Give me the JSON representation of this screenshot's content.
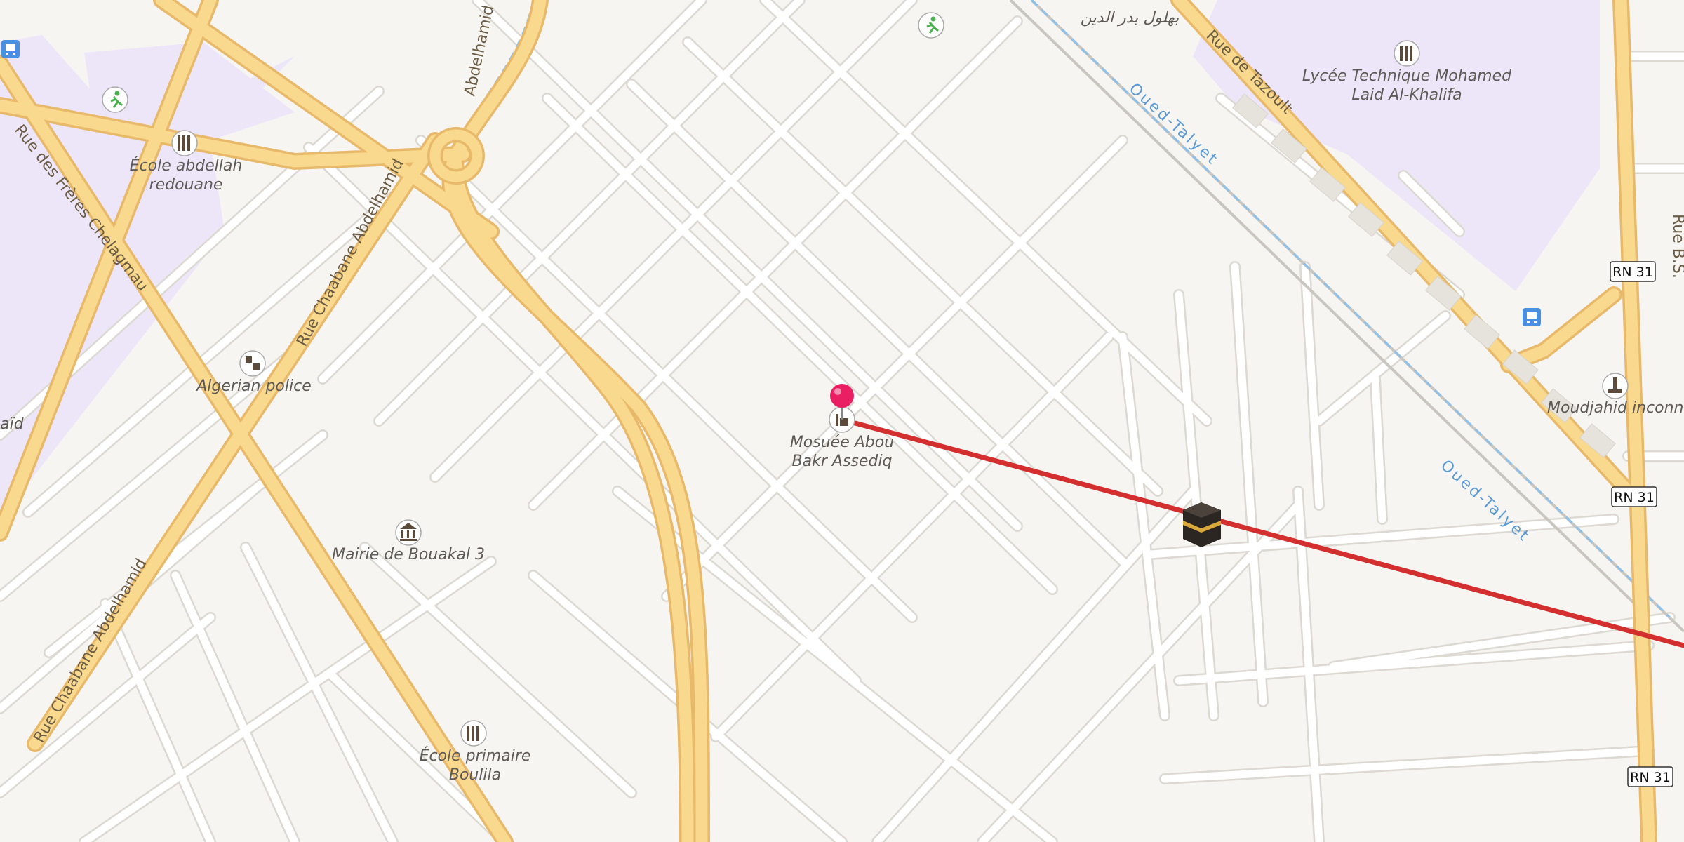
{
  "map": {
    "colors": {
      "land": "#f7f5f2",
      "minor_road": "#ffffff",
      "major_road": "#f8d98d",
      "major_road_casing": "#e8b96a",
      "school_area": "#ede6f8",
      "route_line": "#d32f2f",
      "pin": "#e91e63",
      "water": "#8ec1ea"
    },
    "pois": [
      {
        "name": "École abdellah redouane",
        "line1": "École abdellah",
        "line2": "redouane",
        "icon": "school-icon"
      },
      {
        "name": "Algerian police",
        "line1": "Algerian police",
        "icon": "police-icon"
      },
      {
        "name": "Mairie de Bouakal 3",
        "line1": "Mairie de Bouakal 3",
        "icon": "town-hall-icon"
      },
      {
        "name": "École primaire Boulila",
        "line1": "École primaire",
        "line2": "Boulila",
        "icon": "school-icon"
      },
      {
        "name": "Mosuée Abou Bakr Assediq",
        "line1": "Mosuée Abou",
        "line2": "Bakr Assediq",
        "icon": "mosque-icon"
      },
      {
        "name": "Lycée Technique Mohamed Laid Al-Khalifa",
        "line1": "Lycée Technique Mohamed",
        "line2": "Laid Al-Khalifa",
        "icon": "school-icon"
      },
      {
        "name": "Moudjahid inconnu",
        "line1": "Moudjahid inconnu",
        "icon": "monument-icon"
      },
      {
        "name": "بهلول بدر الدين",
        "line1": "بهلول بدر الدين",
        "icon": ""
      }
    ],
    "streets": [
      {
        "name": "Rue des Frères Chelagmau"
      },
      {
        "name": "Rue Chaabane Abdelhamid"
      },
      {
        "name": "Rue Chaabane Abdelhamid"
      },
      {
        "name": "Abdelhamid"
      },
      {
        "name": "Rue de Tazoult"
      },
      {
        "name": "Rue B.S."
      }
    ],
    "waterways": [
      {
        "name": "Oued-Talyet"
      },
      {
        "name": "Oued-Talyet"
      }
    ],
    "route_shields": [
      "RN 31",
      "RN 31",
      "RN 31"
    ],
    "edge_labels": {
      "left": "laïd"
    },
    "qibla_marker": {
      "icon": "kaaba-icon"
    }
  }
}
